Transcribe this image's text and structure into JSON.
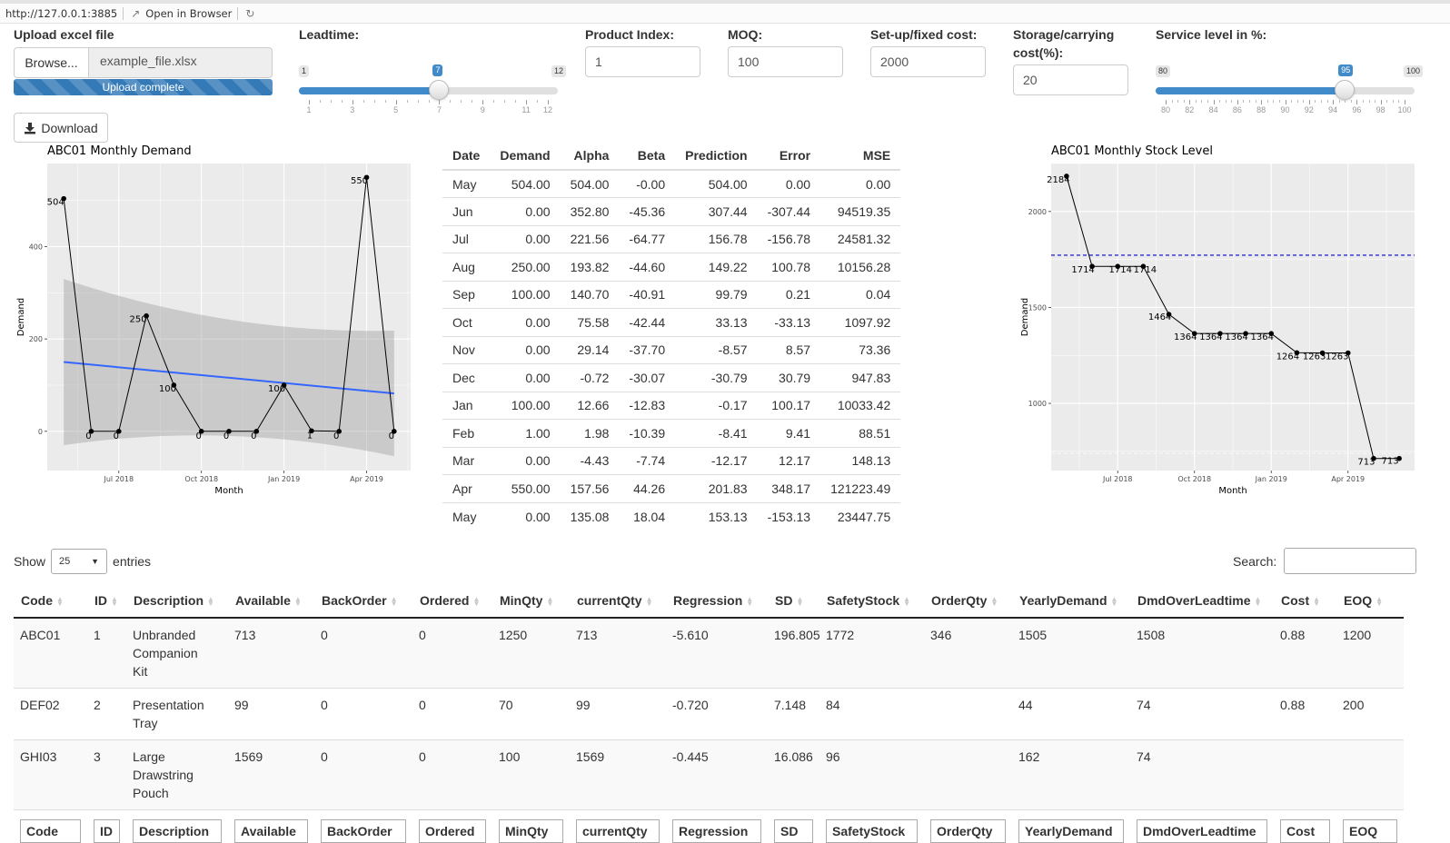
{
  "browser": {
    "url": "http://127.0.0.1:3885",
    "open_label": "Open in Browser"
  },
  "controls": {
    "upload": {
      "label": "Upload excel file",
      "browse_label": "Browse...",
      "filename": "example_file.xlsx",
      "progress_text": "Upload complete",
      "progress_percent": 100
    },
    "leadtime": {
      "label": "Leadtime:",
      "min": "1",
      "max": "12",
      "value": "7",
      "ticks": [
        "1",
        "3",
        "5",
        "7",
        "9",
        "11",
        "12"
      ]
    },
    "product_index": {
      "label": "Product Index:",
      "value": "1"
    },
    "moq": {
      "label": "MOQ:",
      "value": "100"
    },
    "setup_cost": {
      "label": "Set-up/fixed cost:",
      "value": "2000"
    },
    "storage_cost": {
      "label_line1": "Storage/carrying",
      "label_line2": "cost(%):",
      "value": "20"
    },
    "service_level": {
      "label": "Service level in %:",
      "min": "80",
      "max": "100",
      "value": "95",
      "ticks": [
        "80",
        "82",
        "84",
        "86",
        "88",
        "90",
        "92",
        "94",
        "96",
        "98",
        "100"
      ]
    }
  },
  "download_label": "Download",
  "demand_chart": {
    "title": "ABC01 Monthly Demand",
    "xlabel": "Month",
    "ylabel": "Demand",
    "x_ticks": [
      "Jul 2018",
      "Oct 2018",
      "Jan 2019",
      "Apr 2019"
    ],
    "y_ticks": [
      "0",
      "200",
      "400"
    ],
    "point_labels": [
      "504",
      "0",
      "0",
      "250",
      "100",
      "0",
      "0",
      "0",
      "100",
      "1",
      "0",
      "550",
      "0"
    ]
  },
  "stock_chart": {
    "title": "ABC01 Monthly Stock Level",
    "xlabel": "Month",
    "ylabel": "Demand",
    "x_ticks": [
      "Jul 2018",
      "Oct 2018",
      "Jan 2019",
      "Apr 2019"
    ],
    "y_ticks": [
      "1000",
      "1500",
      "2000"
    ],
    "point_labels": [
      "2184",
      "1714",
      "1714",
      "1714",
      "1464",
      "1364",
      "1364",
      "1364",
      "1364",
      "1264",
      "1263",
      "1263",
      "713",
      "713"
    ]
  },
  "chart_data": [
    {
      "type": "line",
      "title": "ABC01 Monthly Demand",
      "xlabel": "Month",
      "ylabel": "Demand",
      "x": [
        "2018-05",
        "2018-06",
        "2018-07",
        "2018-08",
        "2018-09",
        "2018-10",
        "2018-11",
        "2018-12",
        "2019-01",
        "2019-02",
        "2019-03",
        "2019-04",
        "2019-05"
      ],
      "series": [
        {
          "values": [
            504,
            0,
            0,
            250,
            100,
            0,
            0,
            0,
            100,
            1,
            0,
            550,
            0
          ]
        }
      ],
      "trend_line": {
        "color": "#3366ff",
        "start": 150,
        "end": 82
      },
      "confidence_band": {
        "upper_start": 330,
        "upper_min": 210,
        "upper_end": 218,
        "lower_start": -28,
        "lower_end": -55
      },
      "ylim": [
        -85,
        580
      ],
      "grid": true
    },
    {
      "type": "line",
      "title": "ABC01 Monthly Stock Level",
      "xlabel": "Month",
      "ylabel": "Demand",
      "x": [
        "2018-05",
        "2018-06",
        "2018-07",
        "2018-08",
        "2018-09",
        "2018-10",
        "2018-11",
        "2018-12",
        "2019-01",
        "2019-02",
        "2019-03",
        "2019-04",
        "2019-05",
        "2019-06"
      ],
      "series": [
        {
          "values": [
            2184,
            1714,
            1714,
            1714,
            1464,
            1364,
            1364,
            1364,
            1364,
            1264,
            1263,
            1263,
            713,
            713
          ]
        }
      ],
      "reference_lines": [
        {
          "value": 1772,
          "color": "#0000cc",
          "style": "dashed"
        },
        {
          "value": 740,
          "color": "#ffffff",
          "style": "dashed"
        }
      ],
      "ylim": [
        650,
        2250
      ],
      "grid": true
    }
  ],
  "ses_table": {
    "headers": [
      "Date",
      "Demand",
      "Alpha",
      "Beta",
      "Prediction",
      "Error",
      "MSE"
    ],
    "rows": [
      [
        "May",
        "504.00",
        "504.00",
        "-0.00",
        "504.00",
        "0.00",
        "0.00"
      ],
      [
        "Jun",
        "0.00",
        "352.80",
        "-45.36",
        "307.44",
        "-307.44",
        "94519.35"
      ],
      [
        "Jul",
        "0.00",
        "221.56",
        "-64.77",
        "156.78",
        "-156.78",
        "24581.32"
      ],
      [
        "Aug",
        "250.00",
        "193.82",
        "-44.60",
        "149.22",
        "100.78",
        "10156.28"
      ],
      [
        "Sep",
        "100.00",
        "140.70",
        "-40.91",
        "99.79",
        "0.21",
        "0.04"
      ],
      [
        "Oct",
        "0.00",
        "75.58",
        "-42.44",
        "33.13",
        "-33.13",
        "1097.92"
      ],
      [
        "Nov",
        "0.00",
        "29.14",
        "-37.70",
        "-8.57",
        "8.57",
        "73.36"
      ],
      [
        "Dec",
        "0.00",
        "-0.72",
        "-30.07",
        "-30.79",
        "30.79",
        "947.83"
      ],
      [
        "Jan",
        "100.00",
        "12.66",
        "-12.83",
        "-0.17",
        "100.17",
        "10033.42"
      ],
      [
        "Feb",
        "1.00",
        "1.98",
        "-10.39",
        "-8.41",
        "9.41",
        "88.51"
      ],
      [
        "Mar",
        "0.00",
        "-4.43",
        "-7.74",
        "-12.17",
        "12.17",
        "148.13"
      ],
      [
        "Apr",
        "550.00",
        "157.56",
        "44.26",
        "201.83",
        "348.17",
        "121223.49"
      ],
      [
        "May",
        "0.00",
        "135.08",
        "18.04",
        "153.13",
        "-153.13",
        "23447.75"
      ]
    ]
  },
  "datatable": {
    "show_label": "Show",
    "entries_value": "25",
    "entries_label": "entries",
    "search_label": "Search:",
    "columns": [
      "Code",
      "ID",
      "Description",
      "Available",
      "BackOrder",
      "Ordered",
      "MinQty",
      "currentQty",
      "Regression",
      "SD",
      "SafetyStock",
      "OrderQty",
      "YearlyDemand",
      "DmdOverLeadtime",
      "Cost",
      "EOQ"
    ],
    "rows": [
      {
        "Code": "ABC01",
        "ID": "1",
        "Description": "Unbranded Companion Kit",
        "Available": "713",
        "BackOrder": "0",
        "Ordered": "0",
        "MinQty": "1250",
        "currentQty": "713",
        "Regression": "-5.610",
        "SD": "196.805",
        "SafetyStock": "1772",
        "OrderQty": "346",
        "YearlyDemand": "1505",
        "DmdOverLeadtime": "1508",
        "Cost": "0.88",
        "EOQ": "1200"
      },
      {
        "Code": "DEF02",
        "ID": "2",
        "Description": "Presentation Tray",
        "Available": "99",
        "BackOrder": "0",
        "Ordered": "0",
        "MinQty": "70",
        "currentQty": "99",
        "Regression": "-0.720",
        "SD": "7.148",
        "SafetyStock": "84",
        "OrderQty": "",
        "YearlyDemand": "44",
        "DmdOverLeadtime": "74",
        "Cost": "0.88",
        "EOQ": "200"
      },
      {
        "Code": "GHI03",
        "ID": "3",
        "Description": "Large Drawstring Pouch",
        "Available": "1569",
        "BackOrder": "0",
        "Ordered": "0",
        "MinQty": "100",
        "currentQty": "1569",
        "Regression": "-0.445",
        "SD": "16.086",
        "SafetyStock": "96",
        "OrderQty": "",
        "YearlyDemand": "162",
        "DmdOverLeadtime": "74",
        "Cost": "",
        "EOQ": ""
      }
    ]
  }
}
